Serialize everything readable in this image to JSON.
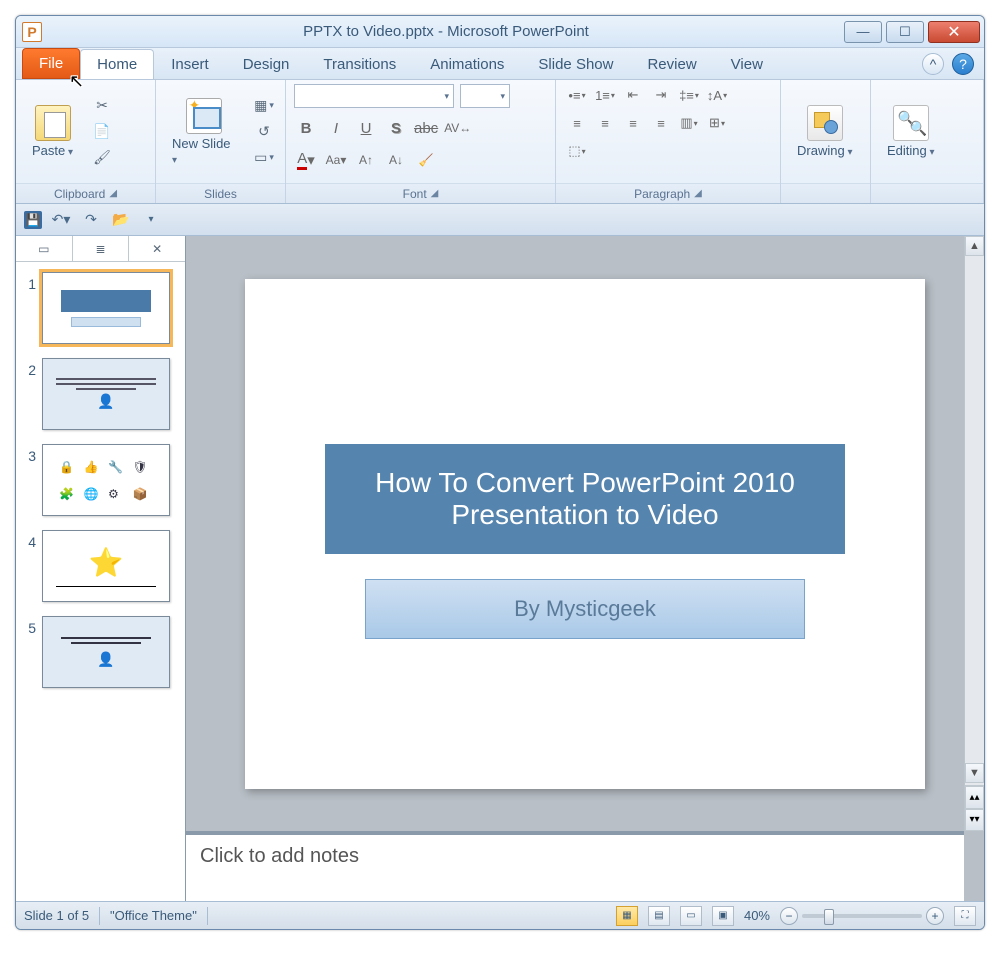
{
  "window": {
    "app_letter": "P",
    "title": "PPTX to Video.pptx - Microsoft PowerPoint"
  },
  "tabs": {
    "file": "File",
    "home": "Home",
    "insert": "Insert",
    "design": "Design",
    "transitions": "Transitions",
    "animations": "Animations",
    "slideshow": "Slide Show",
    "review": "Review",
    "view": "View"
  },
  "ribbon": {
    "paste": "Paste",
    "newslide": "New Slide",
    "drawing": "Drawing",
    "editing": "Editing",
    "groups": {
      "clipboard": "Clipboard",
      "slides": "Slides",
      "font": "Font",
      "paragraph": "Paragraph"
    }
  },
  "thumbs": [
    "1",
    "2",
    "3",
    "4",
    "5"
  ],
  "slide": {
    "title": "How To Convert PowerPoint 2010 Presentation to Video",
    "subtitle": "By Mysticgeek"
  },
  "notes_placeholder": "Click to add notes",
  "status": {
    "slide": "Slide 1 of 5",
    "theme": "\"Office Theme\"",
    "zoom": "40%"
  }
}
